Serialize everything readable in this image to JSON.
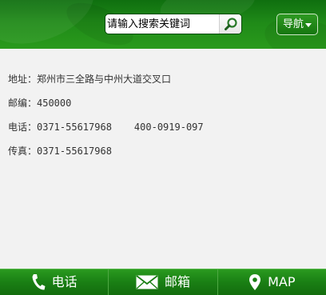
{
  "header": {
    "search": {
      "placeholder": "请输入搜索关键词",
      "button_icon": "search-icon"
    },
    "nav": {
      "label": "导航",
      "icon": "caret-down-icon"
    },
    "colors": {
      "header_green": "#1f8a18",
      "footer_green": "#1a7f14"
    }
  },
  "contact": {
    "address": "地址：郑州市三全路与中州大道交叉口",
    "postcode": "邮编：450000",
    "phone": "电话：0371-55617968",
    "phone_alt": "400-0919-097",
    "fax": "传真：0371-55617968"
  },
  "footer": {
    "items": [
      {
        "label": "电话",
        "icon": "phone-icon"
      },
      {
        "label": "邮箱",
        "icon": "envelope-icon"
      },
      {
        "label": "MAP",
        "icon": "map-pin-icon"
      }
    ]
  }
}
